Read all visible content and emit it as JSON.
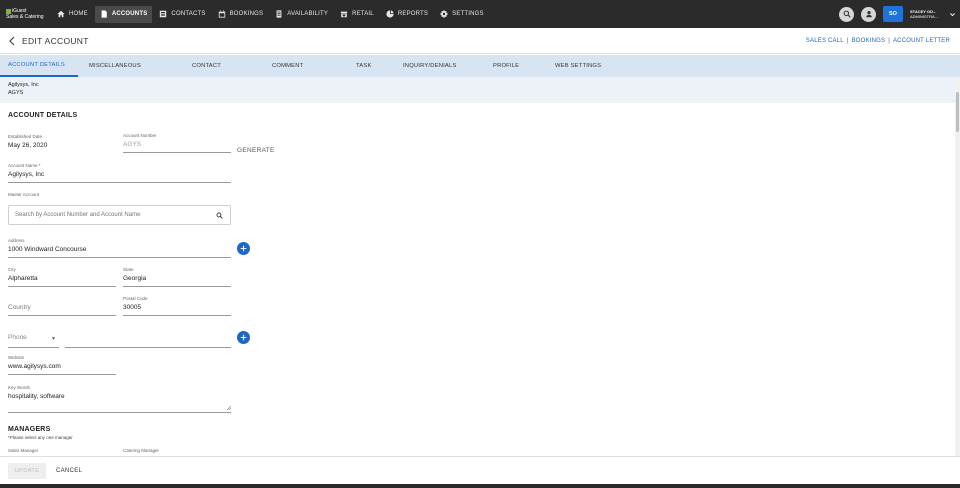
{
  "app": {
    "logo_line1": "iGuest",
    "logo_line2": "Sales & Catering"
  },
  "nav": {
    "items": [
      {
        "label": "HOME",
        "icon": "home-icon"
      },
      {
        "label": "ACCOUNTS",
        "icon": "document-icon",
        "active": true
      },
      {
        "label": "CONTACTS",
        "icon": "contacts-icon"
      },
      {
        "label": "BOOKINGS",
        "icon": "calendar-icon"
      },
      {
        "label": "AVAILABILITY",
        "icon": "availability-icon"
      },
      {
        "label": "RETAIL",
        "icon": "retail-icon"
      },
      {
        "label": "REPORTS",
        "icon": "reports-icon"
      },
      {
        "label": "SETTINGS",
        "icon": "gear-icon"
      }
    ]
  },
  "user": {
    "initials": "SO",
    "name": "STACEY OD...",
    "role": "ADMINISTRA..."
  },
  "header": {
    "title": "EDIT ACCOUNT",
    "links": [
      "SALES CALL",
      "BOOKINGS",
      "ACCOUNT LETTER"
    ],
    "separator": "|"
  },
  "tabs": [
    "ACCOUNT DETAILS",
    "MISCELLANEOUS",
    "CONTACT",
    "COMMENT",
    "TASK",
    "INQUIRY/DENIALS",
    "PROFILE",
    "WEB SETTINGS"
  ],
  "subheader": {
    "account_name": "Agilysys, Inc",
    "account_code": "AGYS"
  },
  "form": {
    "section_title": "ACCOUNT DETAILS",
    "established_date_label": "Established Date",
    "established_date": "May 26, 2020",
    "account_number_label": "Account Number",
    "account_number": "AGYS",
    "generate_label": "GENERATE",
    "account_name_label": "Account Name *",
    "account_name": "Agilysys, Inc",
    "master_account_label": "Master Account",
    "master_account_placeholder": "Search by Account Number and Account Name",
    "address_label": "Address",
    "address": "1000 Windward Concourse",
    "city_label": "City",
    "city": "Alpharetta",
    "state_label": "State",
    "state": "Georgia",
    "country_placeholder": "Country",
    "postal_code_label": "Postal Code",
    "postal_code": "30005",
    "phone_type": "Phone",
    "website_label": "Website",
    "website": "www.agilysys.com",
    "keywords_label": "Key Words",
    "keywords": "hospitality, software"
  },
  "managers": {
    "title": "MANAGERS",
    "note": "*Please select any one manager",
    "sales_manager_label": "Sales Manager",
    "catering_manager_label": "Catering Manager"
  },
  "footer": {
    "update_label": "UPDATE",
    "cancel_label": "CANCEL"
  }
}
